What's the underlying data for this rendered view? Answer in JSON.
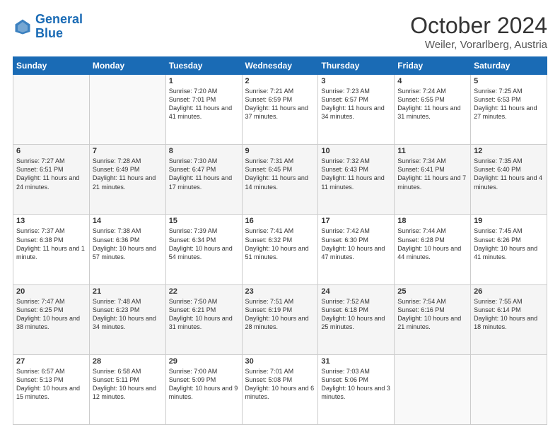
{
  "header": {
    "logo_line1": "General",
    "logo_line2": "Blue",
    "month": "October 2024",
    "location": "Weiler, Vorarlberg, Austria"
  },
  "days_of_week": [
    "Sunday",
    "Monday",
    "Tuesday",
    "Wednesday",
    "Thursday",
    "Friday",
    "Saturday"
  ],
  "weeks": [
    [
      {
        "day": "",
        "info": ""
      },
      {
        "day": "",
        "info": ""
      },
      {
        "day": "1",
        "info": "Sunrise: 7:20 AM\nSunset: 7:01 PM\nDaylight: 11 hours and 41 minutes."
      },
      {
        "day": "2",
        "info": "Sunrise: 7:21 AM\nSunset: 6:59 PM\nDaylight: 11 hours and 37 minutes."
      },
      {
        "day": "3",
        "info": "Sunrise: 7:23 AM\nSunset: 6:57 PM\nDaylight: 11 hours and 34 minutes."
      },
      {
        "day": "4",
        "info": "Sunrise: 7:24 AM\nSunset: 6:55 PM\nDaylight: 11 hours and 31 minutes."
      },
      {
        "day": "5",
        "info": "Sunrise: 7:25 AM\nSunset: 6:53 PM\nDaylight: 11 hours and 27 minutes."
      }
    ],
    [
      {
        "day": "6",
        "info": "Sunrise: 7:27 AM\nSunset: 6:51 PM\nDaylight: 11 hours and 24 minutes."
      },
      {
        "day": "7",
        "info": "Sunrise: 7:28 AM\nSunset: 6:49 PM\nDaylight: 11 hours and 21 minutes."
      },
      {
        "day": "8",
        "info": "Sunrise: 7:30 AM\nSunset: 6:47 PM\nDaylight: 11 hours and 17 minutes."
      },
      {
        "day": "9",
        "info": "Sunrise: 7:31 AM\nSunset: 6:45 PM\nDaylight: 11 hours and 14 minutes."
      },
      {
        "day": "10",
        "info": "Sunrise: 7:32 AM\nSunset: 6:43 PM\nDaylight: 11 hours and 11 minutes."
      },
      {
        "day": "11",
        "info": "Sunrise: 7:34 AM\nSunset: 6:41 PM\nDaylight: 11 hours and 7 minutes."
      },
      {
        "day": "12",
        "info": "Sunrise: 7:35 AM\nSunset: 6:40 PM\nDaylight: 11 hours and 4 minutes."
      }
    ],
    [
      {
        "day": "13",
        "info": "Sunrise: 7:37 AM\nSunset: 6:38 PM\nDaylight: 11 hours and 1 minute."
      },
      {
        "day": "14",
        "info": "Sunrise: 7:38 AM\nSunset: 6:36 PM\nDaylight: 10 hours and 57 minutes."
      },
      {
        "day": "15",
        "info": "Sunrise: 7:39 AM\nSunset: 6:34 PM\nDaylight: 10 hours and 54 minutes."
      },
      {
        "day": "16",
        "info": "Sunrise: 7:41 AM\nSunset: 6:32 PM\nDaylight: 10 hours and 51 minutes."
      },
      {
        "day": "17",
        "info": "Sunrise: 7:42 AM\nSunset: 6:30 PM\nDaylight: 10 hours and 47 minutes."
      },
      {
        "day": "18",
        "info": "Sunrise: 7:44 AM\nSunset: 6:28 PM\nDaylight: 10 hours and 44 minutes."
      },
      {
        "day": "19",
        "info": "Sunrise: 7:45 AM\nSunset: 6:26 PM\nDaylight: 10 hours and 41 minutes."
      }
    ],
    [
      {
        "day": "20",
        "info": "Sunrise: 7:47 AM\nSunset: 6:25 PM\nDaylight: 10 hours and 38 minutes."
      },
      {
        "day": "21",
        "info": "Sunrise: 7:48 AM\nSunset: 6:23 PM\nDaylight: 10 hours and 34 minutes."
      },
      {
        "day": "22",
        "info": "Sunrise: 7:50 AM\nSunset: 6:21 PM\nDaylight: 10 hours and 31 minutes."
      },
      {
        "day": "23",
        "info": "Sunrise: 7:51 AM\nSunset: 6:19 PM\nDaylight: 10 hours and 28 minutes."
      },
      {
        "day": "24",
        "info": "Sunrise: 7:52 AM\nSunset: 6:18 PM\nDaylight: 10 hours and 25 minutes."
      },
      {
        "day": "25",
        "info": "Sunrise: 7:54 AM\nSunset: 6:16 PM\nDaylight: 10 hours and 21 minutes."
      },
      {
        "day": "26",
        "info": "Sunrise: 7:55 AM\nSunset: 6:14 PM\nDaylight: 10 hours and 18 minutes."
      }
    ],
    [
      {
        "day": "27",
        "info": "Sunrise: 6:57 AM\nSunset: 5:13 PM\nDaylight: 10 hours and 15 minutes."
      },
      {
        "day": "28",
        "info": "Sunrise: 6:58 AM\nSunset: 5:11 PM\nDaylight: 10 hours and 12 minutes."
      },
      {
        "day": "29",
        "info": "Sunrise: 7:00 AM\nSunset: 5:09 PM\nDaylight: 10 hours and 9 minutes."
      },
      {
        "day": "30",
        "info": "Sunrise: 7:01 AM\nSunset: 5:08 PM\nDaylight: 10 hours and 6 minutes."
      },
      {
        "day": "31",
        "info": "Sunrise: 7:03 AM\nSunset: 5:06 PM\nDaylight: 10 hours and 3 minutes."
      },
      {
        "day": "",
        "info": ""
      },
      {
        "day": "",
        "info": ""
      }
    ]
  ]
}
